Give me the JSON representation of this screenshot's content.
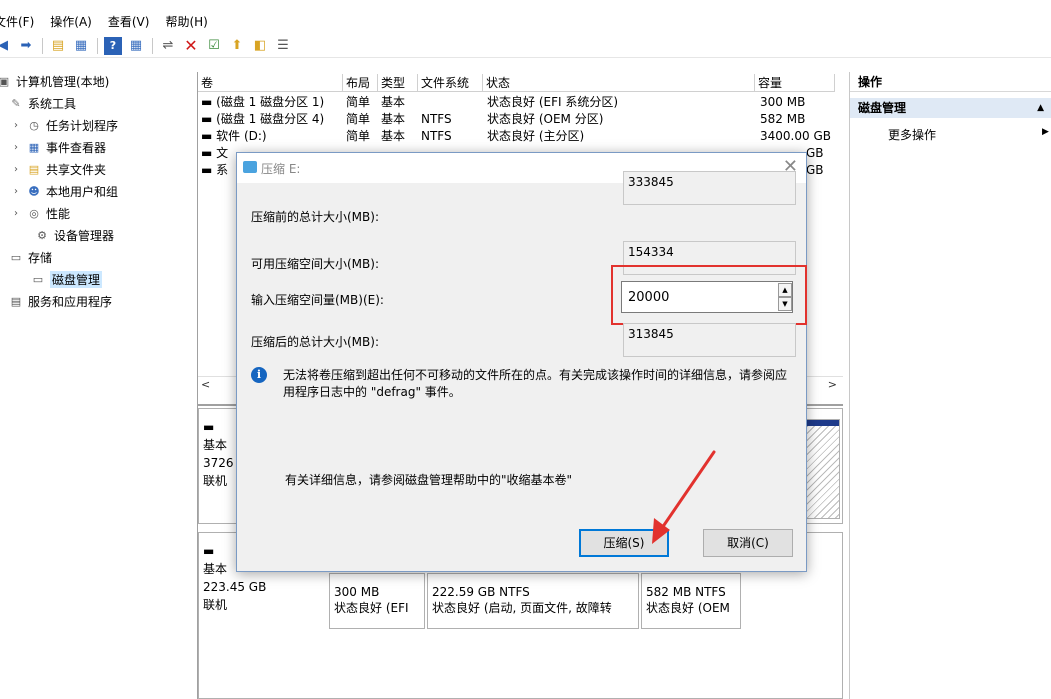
{
  "menubar": {
    "items": [
      "文件(F)",
      "操作(A)",
      "查看(V)",
      "帮助(H)"
    ],
    "first_visible": "文件(F)"
  },
  "toolbar": {
    "icons": [
      "back-icon",
      "forward-icon",
      "up-folder-icon",
      "show-hide-tree-icon",
      "help-icon",
      "properties-icon",
      "connect-icon",
      "delete-icon",
      "check-icon",
      "import-icon",
      "export-icon",
      "list-icon"
    ]
  },
  "tree": {
    "root": "计算机管理(本地)",
    "items": [
      {
        "label": "系统工具"
      },
      {
        "label": "任务计划程序"
      },
      {
        "label": "事件查看器"
      },
      {
        "label": "共享文件夹"
      },
      {
        "label": "本地用户和组"
      },
      {
        "label": "性能"
      },
      {
        "label": "设备管理器"
      },
      {
        "label": "存储"
      },
      {
        "label": "磁盘管理"
      },
      {
        "label": "服务和应用程序"
      }
    ]
  },
  "volumes": {
    "headers": [
      "卷",
      "布局",
      "类型",
      "文件系统",
      "状态",
      "容量"
    ],
    "rows": [
      {
        "name": "(磁盘 1 磁盘分区 1)",
        "layout": "简单",
        "type": "基本",
        "fs": "",
        "status": "状态良好 (EFI 系统分区)",
        "capacity": "300 MB"
      },
      {
        "name": "(磁盘 1 磁盘分区 4)",
        "layout": "简单",
        "type": "基本",
        "fs": "NTFS",
        "status": "状态良好 (OEM 分区)",
        "capacity": "582 MB"
      },
      {
        "name": "软件 (D:)",
        "layout": "简单",
        "type": "基本",
        "fs": "NTFS",
        "status": "状态良好 (主分区)",
        "capacity": "3400.00 GB"
      },
      {
        "name": "文",
        "capacity": "GB"
      },
      {
        "name": "系",
        "capacity": "GB"
      }
    ],
    "scroll_left": "<",
    "scroll_right": ">"
  },
  "disks": {
    "disk0": {
      "line1": "基本",
      "line2": "3726",
      "line3": "联机"
    },
    "disk1": {
      "line1": "基本",
      "line2": "223.45 GB",
      "line3": "联机"
    },
    "parts": [
      {
        "size": "300 MB",
        "status": "状态良好 (EFI"
      },
      {
        "size": "222.59 GB NTFS",
        "status": "状态良好 (启动, 页面文件, 故障转"
      },
      {
        "size": "582 MB NTFS",
        "status": "状态良好 (OEM"
      }
    ]
  },
  "actions": {
    "header": "操作",
    "section": "磁盘管理",
    "more": "更多操作"
  },
  "dialog": {
    "title": "压缩 E:",
    "total_before_label": "压缩前的总计大小(MB):",
    "total_before_value": "333845",
    "available_label": "可用压缩空间大小(MB):",
    "available_value": "154334",
    "input_label": "输入压缩空间量(MB)(E):",
    "input_value": "20000",
    "total_after_label": "压缩后的总计大小(MB):",
    "total_after_value": "313845",
    "info_text": "无法将卷压缩到超出任何不可移动的文件所在的点。有关完成该操作时间的详细信息，请参阅应用程序日志中的 \"defrag\" 事件。",
    "help_text": "有关详细信息，请参阅磁盘管理帮助中的\"收缩基本卷\"",
    "shrink_button": "压缩(S)",
    "cancel_button": "取消(C)"
  },
  "colors": {
    "highlight": "#e2322e",
    "selection": "#cce8ff",
    "partition_header": "#1e3a8a"
  }
}
